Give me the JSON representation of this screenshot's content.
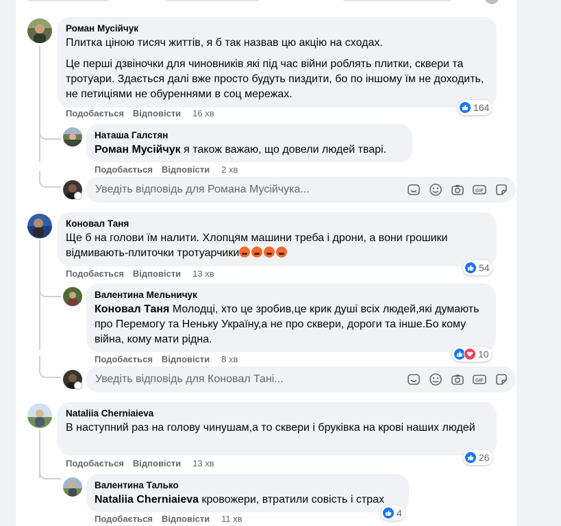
{
  "colors": {
    "accent": "#1877f2",
    "love": "#f33e58",
    "secondary_text": "#65676b",
    "bubble": "#f0f2f5"
  },
  "actions": {
    "like": "Подобається",
    "reply": "Відповісти"
  },
  "comments": [
    {
      "author": "Роман Мусійчук",
      "paragraphs": [
        "Плитка ціною тисяч життів, я б так назвав цю акцію на сходах.",
        "Це перші дзвіночки для чиновників які під час війни роблять плитки, сквери та тротуари. Здається далі вже просто будуть пиздити, бо по іншому їм не доходить, не петиціями не обуреннями в соц мережах."
      ],
      "time": "16 хв",
      "reaction_count": "164",
      "reaction_icons": [
        "like-icon"
      ],
      "replies": [
        {
          "author": "Наташа Галстян",
          "mention": "Роман Мусійчук",
          "text": " я також важаю, що довели людей тварі.",
          "time": "2 хв"
        }
      ],
      "reply_placeholder": "Уведіть відповідь для Романа Мусійчука..."
    },
    {
      "author": "Коновал Таня",
      "text": "Ще б на голови їм налити. Хлопцям машини треба і дрони, а вони грошики відмивають-плиточки тротуарчики",
      "emoji": [
        "angry-face-emoji",
        "angry-face-emoji",
        "angry-face-emoji",
        "angry-face-emoji"
      ],
      "time": "13 хв",
      "reaction_count": "54",
      "reaction_icons": [
        "like-icon"
      ],
      "replies": [
        {
          "author": "Валентина Мельничук",
          "mention": "Коновал Таня",
          "text": " Молодці, хто це зробив,це крик душі всіх людей,які думають про Перемогу та Неньку Україну,а не про сквери, дороги та інше.Бо кому війна, кому мати рідна.",
          "time": "8 хв",
          "reaction_count": "10",
          "reaction_icons": [
            "like-icon",
            "love-icon"
          ]
        }
      ],
      "reply_placeholder": "Уведіть відповідь для Коновал Тані..."
    },
    {
      "author": "Nataliia Cherniaieva",
      "text": "В наступний раз на голову чинушам,а то сквери і бруківка на крові наших людей",
      "time": "13 хв",
      "reaction_count": "26",
      "reaction_icons": [
        "like-icon"
      ],
      "replies": [
        {
          "author": "Валентина Талько",
          "mention": "Nataliia Cherniaieva",
          "text": " кровожери, втратили совість і страх",
          "time": "11 хв",
          "reaction_count": "4",
          "reaction_icons": [
            "like-icon"
          ]
        }
      ]
    }
  ],
  "composer_icons": [
    "sticker-alt-icon",
    "emoji-icon",
    "camera-icon",
    "gif-icon",
    "sticker-icon"
  ]
}
